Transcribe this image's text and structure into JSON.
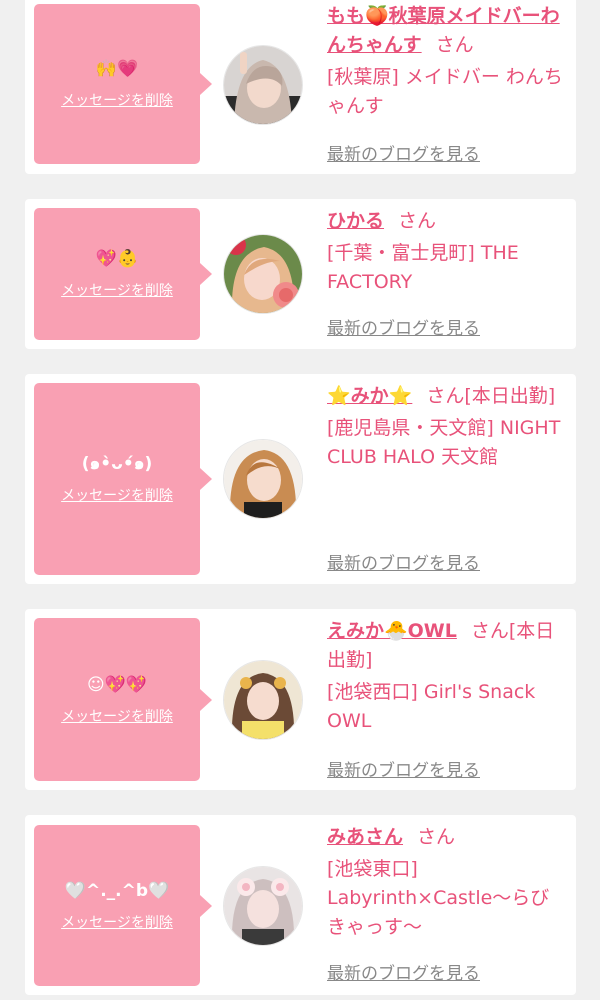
{
  "colors": {
    "background": "#f0f0f0",
    "card": "#ffffff",
    "bubble": "#f9a0b3",
    "accent": "#e8527a",
    "link_gray": "#888888"
  },
  "entries": [
    {
      "message": "🙌💗",
      "delete_label": "メッセージを削除",
      "name": "もも🍑秋葉原メイドバーわんちゃんす",
      "honorific": "さん",
      "shop": "[秋葉原] メイドバー わんちゃんす",
      "blog_label": "最新のブログを見る",
      "avatar_icon": "user-photo"
    },
    {
      "message": "💖👶",
      "delete_label": "メッセージを削除",
      "name": "ひかる",
      "honorific": "さん",
      "shop": "[千葉・富士見町] THE FACTORY",
      "blog_label": "最新のブログを見る",
      "avatar_icon": "user-photo"
    },
    {
      "message": "(๑•̀ᴗ•́๑)",
      "delete_label": "メッセージを削除",
      "name": "⭐みか⭐",
      "honorific": "さん[本日出勤]",
      "shop": "[鹿児島県・天文館] NIGHT CLUB HALO 天文館",
      "blog_label": "最新のブログを見る",
      "avatar_icon": "user-photo"
    },
    {
      "message": "☺💖💖",
      "delete_label": "メッセージを削除",
      "name": "えみか🐣OWL",
      "honorific": "さん[本日出勤]",
      "shop": "[池袋西口] Girl's Snack OWL",
      "blog_label": "最新のブログを見る",
      "avatar_icon": "user-photo"
    },
    {
      "message": "🤍^._.^b🤍",
      "delete_label": "メッセージを削除",
      "name": "みあさん",
      "honorific": "さん",
      "shop": "[池袋東口] Labyrinth×Castle〜らびきゃっす〜",
      "blog_label": "最新のブログを見る",
      "avatar_icon": "user-photo"
    }
  ]
}
